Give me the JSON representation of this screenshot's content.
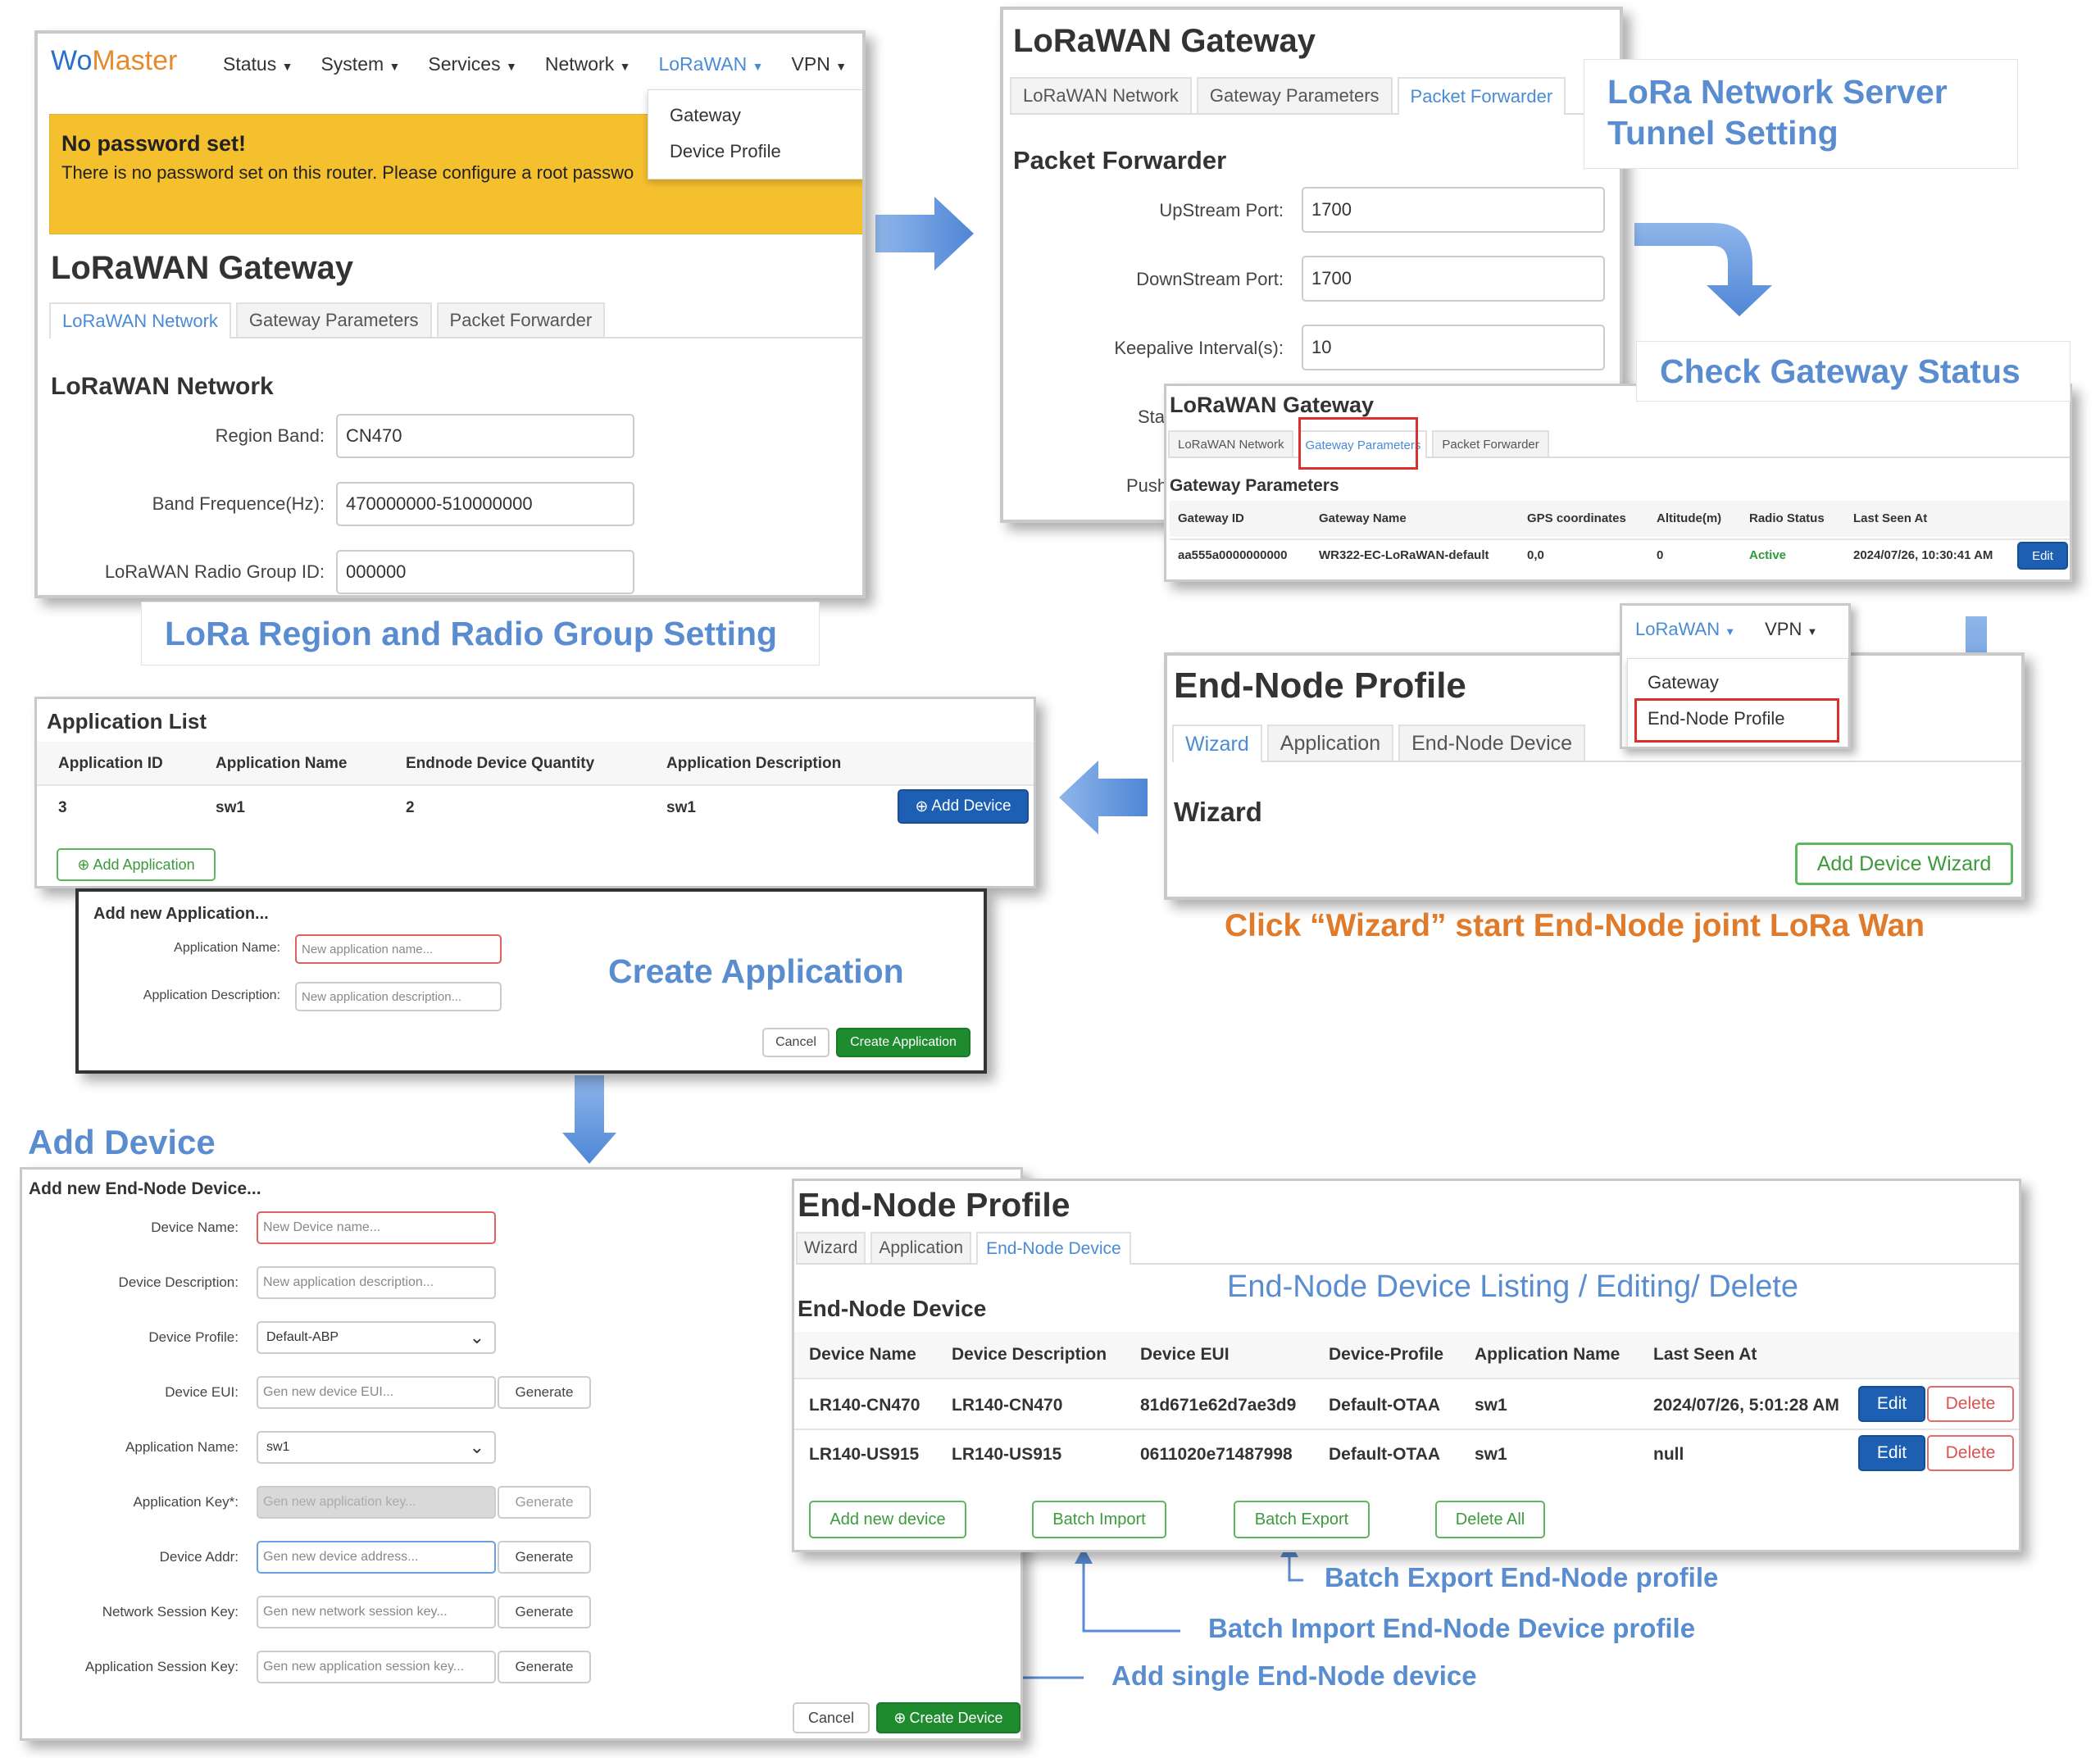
{
  "colors": {
    "accent": "#5a8dd0",
    "orange": "#e07b2c",
    "warning": "#f4c02e",
    "green": "#1e8c2e",
    "blue_btn": "#1c5fb3",
    "red": "#d93030"
  },
  "p1": {
    "brand_wo": "Wo",
    "brand_master": "Master",
    "nav": [
      "Status",
      "System",
      "Services",
      "Network",
      "LoRaWAN",
      "VPN"
    ],
    "dropdown": [
      "Gateway",
      "Device Profile"
    ],
    "alert_title": "No password set!",
    "alert_text": "There is no password set on this router. Please configure a root passwo",
    "title": "LoRaWAN Gateway",
    "tabs": [
      "LoRaWAN Network",
      "Gateway Parameters",
      "Packet Forwarder"
    ],
    "section": "LoRaWAN Network",
    "fields": [
      {
        "label": "Region Band:",
        "value": "CN470"
      },
      {
        "label": "Band Frequence(Hz):",
        "value": "470000000-510000000"
      },
      {
        "label": "LoRaWAN Radio Group ID:",
        "value": "000000"
      }
    ]
  },
  "callouts": {
    "lora_region": "LoRa Region and Radio Group Setting",
    "server_tunnel_1": "LoRa Network Server",
    "server_tunnel_2": "Tunnel Setting",
    "check_status": "Check Gateway Status",
    "wizard": "Click “Wizard” start  End-Node joint LoRa Wan",
    "create_app": "Create Application",
    "add_device": "Add Device",
    "listing": "End-Node Device Listing / Editing/ Delete",
    "batch_export": "Batch Export End-Node profile",
    "batch_import": "Batch Import End-Node Device profile",
    "add_single": "Add single End-Node device"
  },
  "p2": {
    "title": "LoRaWAN Gateway",
    "tabs": [
      "LoRaWAN Network",
      "Gateway Parameters",
      "Packet Forwarder"
    ],
    "section": "Packet Forwarder",
    "fields": [
      {
        "label": "UpStream Port:",
        "value": "1700"
      },
      {
        "label": "DownStream Port:",
        "value": "1700"
      },
      {
        "label": "Keepalive Interval(s):",
        "value": "10"
      }
    ],
    "partial_1": "Sta",
    "partial_2": "Push"
  },
  "p3": {
    "title": "LoRaWAN Gateway",
    "tabs": [
      "LoRaWAN Network",
      "Gateway Parameters",
      "Packet Forwarder"
    ],
    "section": "Gateway Parameters",
    "columns": [
      "Gateway ID",
      "Gateway Name",
      "GPS coordinates",
      "Altitude(m)",
      "Radio Status",
      "Last Seen At"
    ],
    "row": {
      "id": "aa555a0000000000",
      "name": "WR322-EC-LoRaWAN-default",
      "gps": "0,0",
      "alt": "0",
      "status": "Active",
      "seen": "2024/07/26, 10:30:41 AM"
    },
    "edit": "Edit"
  },
  "p4": {
    "nav": [
      "LoRaWAN",
      "VPN"
    ],
    "dropdown": [
      "Gateway",
      "End-Node Profile"
    ],
    "title": "End-Node Profile",
    "tabs": [
      "Wizard",
      "Application",
      "End-Node Device"
    ],
    "section": "Wizard",
    "button": "Add Device Wizard"
  },
  "p5": {
    "title": "Application List",
    "columns": [
      "Application ID",
      "Application Name",
      "Endnode Device Quantity",
      "Application Description"
    ],
    "row": {
      "id": "3",
      "name": "sw1",
      "qty": "2",
      "desc": "sw1"
    },
    "add_device": "Add Device",
    "add_app": "Add Application"
  },
  "p6": {
    "title": "Add new Application...",
    "fields": [
      {
        "label": "Application Name:",
        "placeholder": "New application name..."
      },
      {
        "label": "Application Description:",
        "placeholder": "New application description..."
      }
    ],
    "cancel": "Cancel",
    "create": "Create Application"
  },
  "p7": {
    "title": "Add new End-Node Device...",
    "fields": [
      {
        "label": "Device Name:",
        "value": "New Device name..."
      },
      {
        "label": "Device Description:",
        "value": "New application description..."
      },
      {
        "label": "Device Profile:",
        "value": "Default-ABP"
      },
      {
        "label": "Device EUI:",
        "value": "Gen new device EUI..."
      },
      {
        "label": "Application Name:",
        "value": "sw1"
      },
      {
        "label": "Application Key*:",
        "value": "Gen new application key..."
      },
      {
        "label": "Device Addr:",
        "value": "Gen new device address..."
      },
      {
        "label": "Network Session Key:",
        "value": "Gen new network session key..."
      },
      {
        "label": "Application Session Key:",
        "value": "Gen new application session key..."
      }
    ],
    "generate": "Generate",
    "cancel": "Cancel",
    "create": "Create Device"
  },
  "p8": {
    "title": "End-Node Profile",
    "tabs": [
      "Wizard",
      "Application",
      "End-Node Device"
    ],
    "section": "End-Node Device",
    "columns": [
      "Device Name",
      "Device Description",
      "Device EUI",
      "Device-Profile",
      "Application Name",
      "Last Seen At"
    ],
    "rows": [
      {
        "name": "LR140-CN470",
        "desc": "LR140-CN470",
        "eui": "81d671e62d7ae3d9",
        "profile": "Default-OTAA",
        "app": "sw1",
        "seen": "2024/07/26, 5:01:28 AM"
      },
      {
        "name": "LR140-US915",
        "desc": "LR140-US915",
        "eui": "0611020e71487998",
        "profile": "Default-OTAA",
        "app": "sw1",
        "seen": "null"
      }
    ],
    "edit": "Edit",
    "delete": "Delete",
    "actions": [
      "Add new device",
      "Batch Import",
      "Batch Export",
      "Delete All"
    ]
  }
}
